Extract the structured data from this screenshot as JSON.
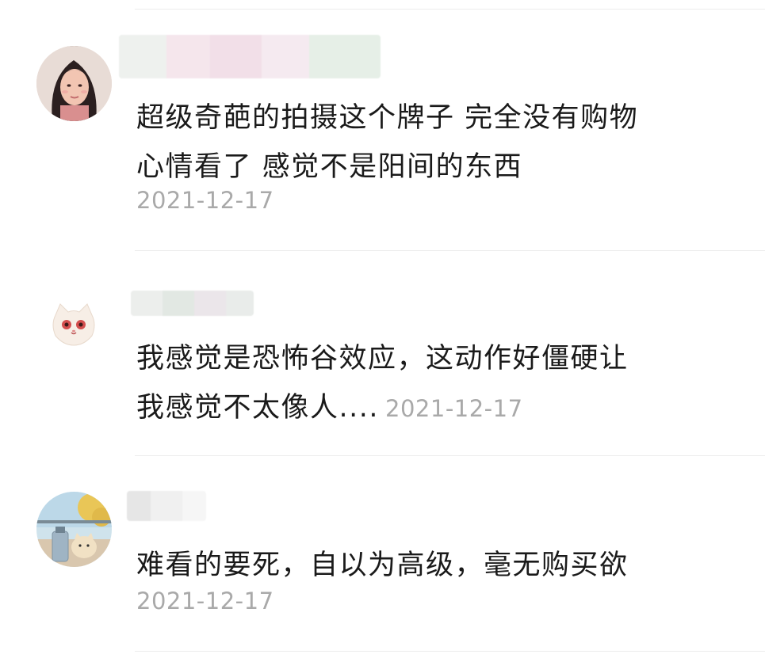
{
  "comments": [
    {
      "line1": "超级奇葩的拍摄这个牌子 完全没有购物",
      "line2": "心情看了 感觉不是阳间的东西",
      "date": "2021-12-17"
    },
    {
      "line1": "我感觉是恐怖谷效应，这动作好僵硬让",
      "line2": "我感觉不太像人....",
      "date": "2021-12-17"
    },
    {
      "line1": "难看的要死，自以为高级，毫无购买欲",
      "date": "2021-12-17"
    }
  ]
}
